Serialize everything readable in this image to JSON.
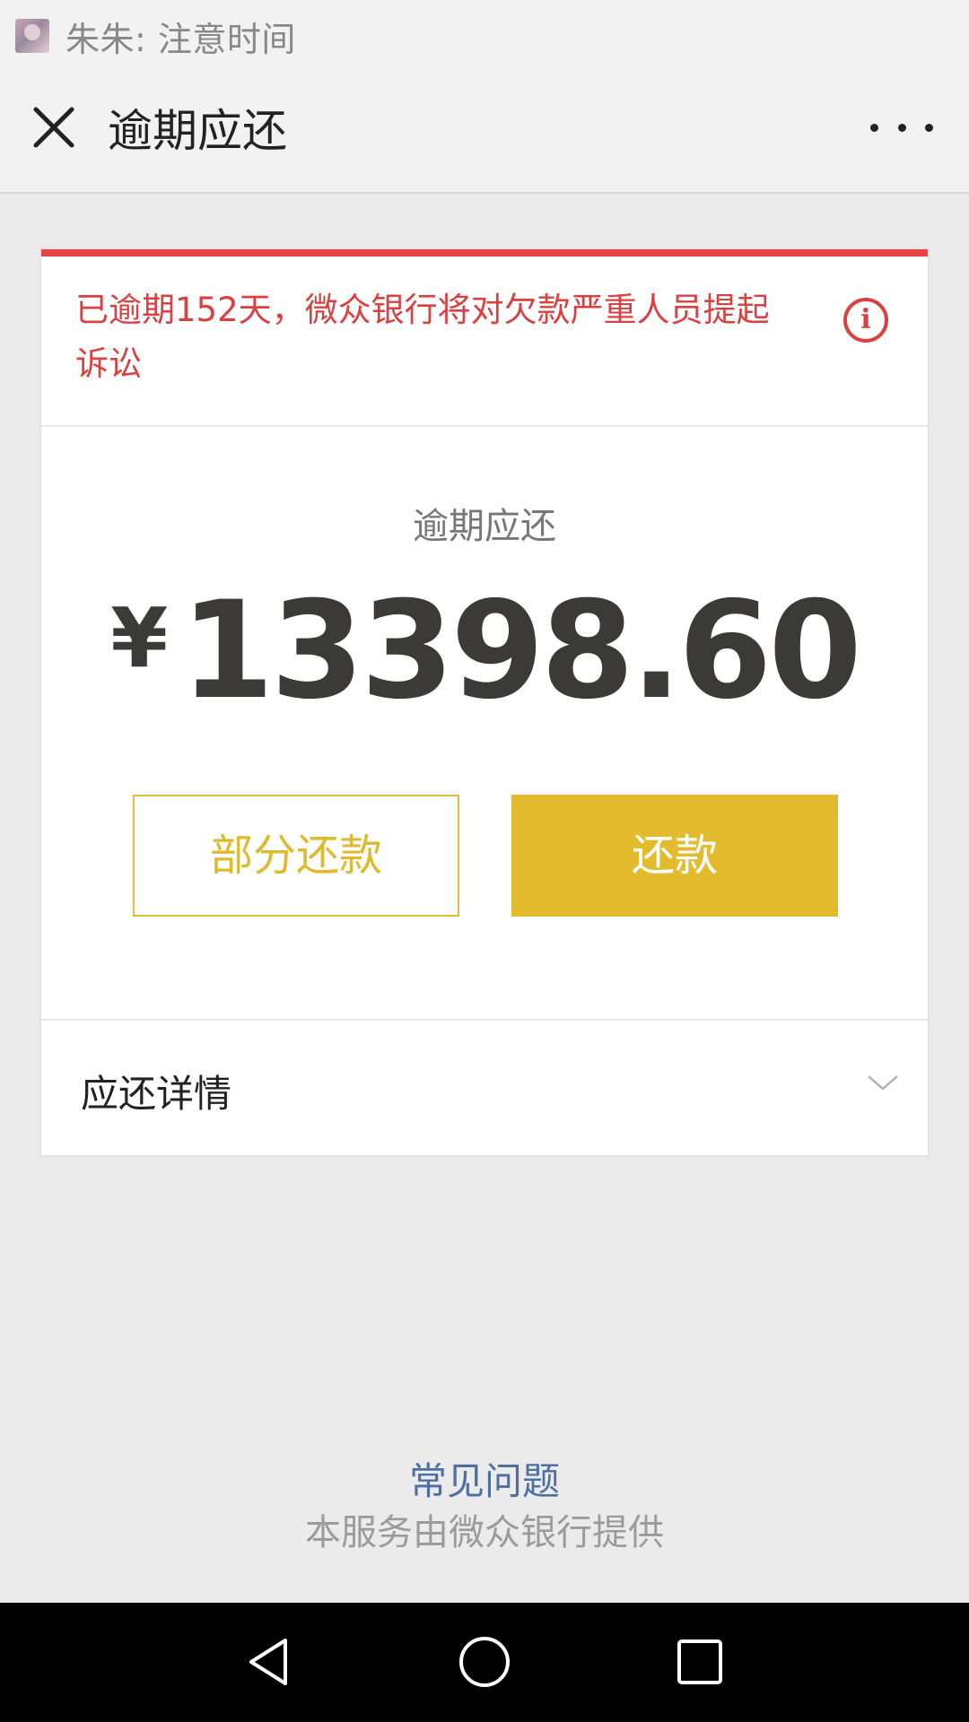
{
  "notification": {
    "text": "朱朱: 注意时间"
  },
  "header": {
    "title": "逾期应还"
  },
  "alert": {
    "message": "已逾期152天，微众银行将对欠款严重人员提起诉讼",
    "icon": "info-icon",
    "color": "#d9403f"
  },
  "amount": {
    "label": "逾期应还",
    "currency": "¥",
    "value": "13398.60"
  },
  "actions": {
    "partial_label": "部分还款",
    "repay_label": "还款",
    "accent_color": "#e3bb2d"
  },
  "details": {
    "label": "应还详情"
  },
  "footer": {
    "faq_label": "常见问题",
    "provider_text": "本服务由微众银行提供"
  }
}
